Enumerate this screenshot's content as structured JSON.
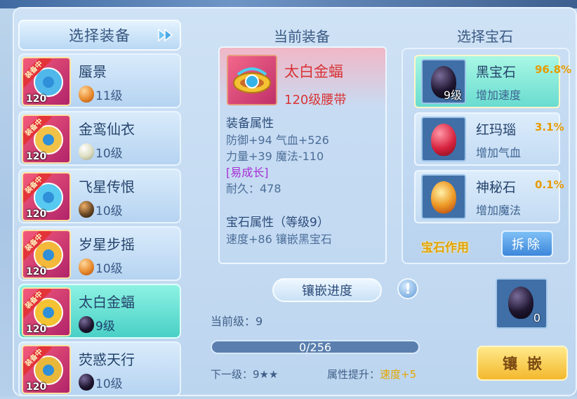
{
  "left": {
    "title": "选择装备",
    "items": [
      {
        "name": "蜃景",
        "level": "120",
        "badge": "装备中",
        "gem_level": "11级",
        "gem": "amber"
      },
      {
        "name": "金鸾仙衣",
        "level": "120",
        "badge": "装备中",
        "gem_level": "10级",
        "gem": "silver"
      },
      {
        "name": "飞星传恨",
        "level": "120",
        "badge": "装备中",
        "gem_level": "10级",
        "gem": "mixed"
      },
      {
        "name": "岁星步摇",
        "level": "120",
        "badge": "装备中",
        "gem_level": "10级",
        "gem": "amber"
      },
      {
        "name": "太白金蝠",
        "level": "120",
        "badge": "装备中",
        "gem_level": "9级",
        "gem": "black"
      },
      {
        "name": "荧惑天行",
        "level": "120",
        "badge": "装备中",
        "gem_level": "10级",
        "gem": "black"
      }
    ]
  },
  "current": {
    "title": "当前装备",
    "name": "太白金蝠",
    "type": "120级腰带",
    "attr_head": "装备属性",
    "attr_lines": [
      "防御+94 气血+526",
      "力量+39 魔法-110"
    ],
    "special": "[易成长]",
    "durability": "耐久：478",
    "gem_head": "宝石属性（等级9）",
    "gem_line": "速度+86 镶嵌黑宝石"
  },
  "progress": {
    "title": "镶嵌进度",
    "current_level": "当前级：9",
    "bar_text": "0/256",
    "fill_fraction": 0.0,
    "next_level": "下一级：9★★",
    "attr_label": "属性提升：",
    "attr_value": "速度+5"
  },
  "gems": {
    "title": "选择宝石",
    "items": [
      {
        "name": "黑宝石",
        "pct": "96.8%",
        "effect": "增加速度",
        "level": "9级",
        "stone": "black"
      },
      {
        "name": "红玛瑙",
        "pct": "3.1%",
        "effect": "增加气血",
        "level": "",
        "stone": "red"
      },
      {
        "name": "神秘石",
        "pct": "0.1%",
        "effect": "增加魔法",
        "level": "",
        "stone": "myst"
      }
    ],
    "usage_label": "宝石作用",
    "remove_label": "拆除"
  },
  "result": {
    "count": "0"
  },
  "inlay_label": "镶嵌",
  "colors": {
    "accent_red": "#d83436",
    "gold": "#e79b00",
    "selected_teal": "#49d0c6"
  }
}
